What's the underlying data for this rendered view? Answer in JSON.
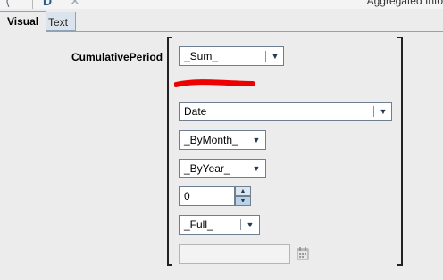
{
  "toolbar": {
    "right_text": "Aggregated Info"
  },
  "tabs": [
    {
      "label": "Visual"
    },
    {
      "label": "Text"
    }
  ],
  "form": {
    "field_label": "CumulativePeriod",
    "aggregate_combo": {
      "value": "_Sum_"
    },
    "date_combo": {
      "value": "Date"
    },
    "period_combo": {
      "value": "_ByMonth_"
    },
    "reset_combo": {
      "value": "_ByYear_"
    },
    "offset_spinner": {
      "value": "0"
    },
    "range_combo": {
      "value": "_Full_"
    },
    "date_field": {
      "value": ""
    }
  },
  "colors": {
    "redaction": "#ee0000",
    "tab_active": "#ececec",
    "tab_inactive": "#dbe3ec"
  },
  "icons": [
    "back-arrow-icon",
    "document-icon",
    "close-icon",
    "chevron-down-icon",
    "spinner-up-icon",
    "spinner-down-icon",
    "calendar-icon"
  ]
}
